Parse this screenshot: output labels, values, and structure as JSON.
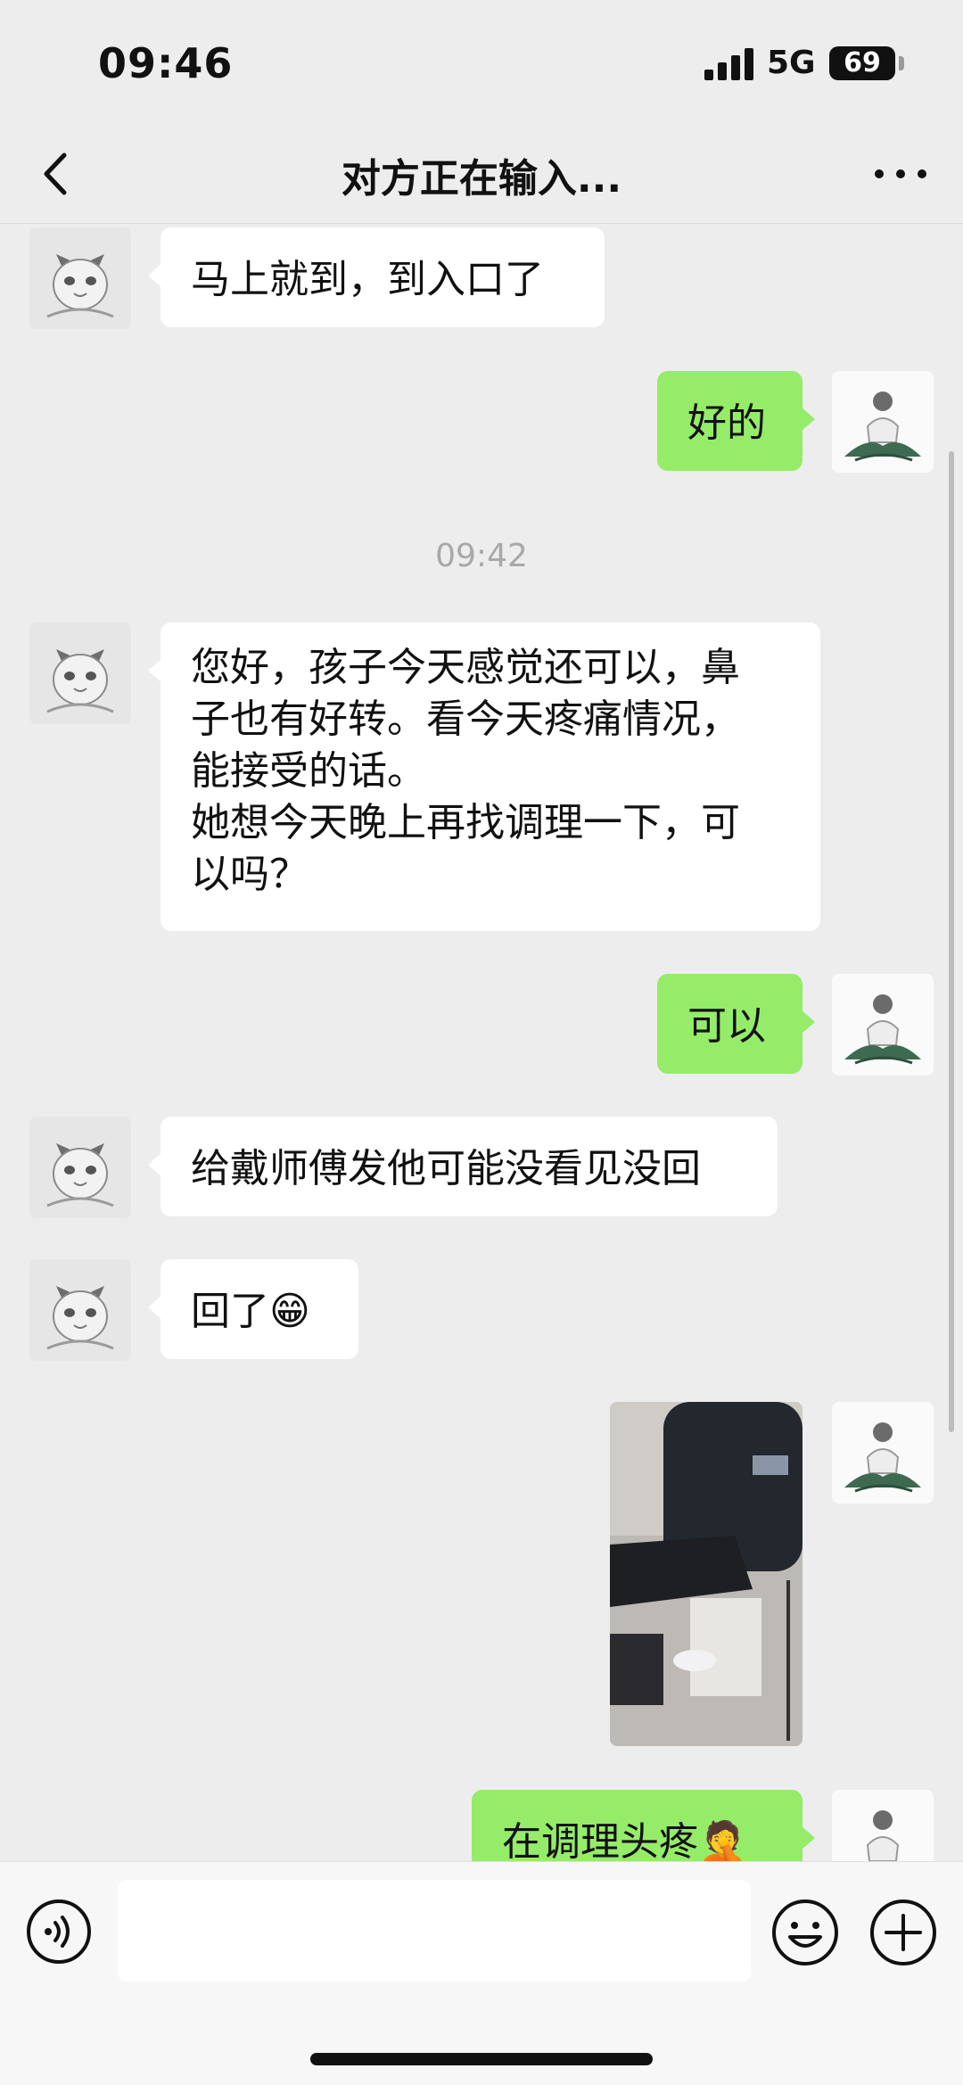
{
  "status_bar": {
    "time": "09:46",
    "network": "5G",
    "battery": "69"
  },
  "nav": {
    "title": "对方正在输入..."
  },
  "messages": [
    {
      "text": "马上就到，到入口了"
    },
    {
      "text": "好的"
    },
    {
      "text": "您好，孩子今天感觉还可以，鼻\n子也有好转。看今天疼痛情况，\n能接受的话。\n她想今天晚上再找调理一下，可\n以吗？"
    },
    {
      "text": "可以"
    },
    {
      "text": "给戴师傅发他可能没看见没回"
    },
    {
      "text": "回了😁"
    },
    {
      "text": "在调理头疼🤦"
    }
  ],
  "timestamp": "09:42",
  "input_bar": {
    "placeholder": ""
  },
  "colors": {
    "outgoing_bubble": "#95EC69",
    "incoming_bubble": "#FFFFFF",
    "background": "#EDEDED"
  },
  "icons": {
    "back": "chevron-left-icon",
    "more": "more-dots-icon",
    "voice": "voice-icon",
    "emoji": "emoji-icon",
    "plus": "plus-icon"
  }
}
